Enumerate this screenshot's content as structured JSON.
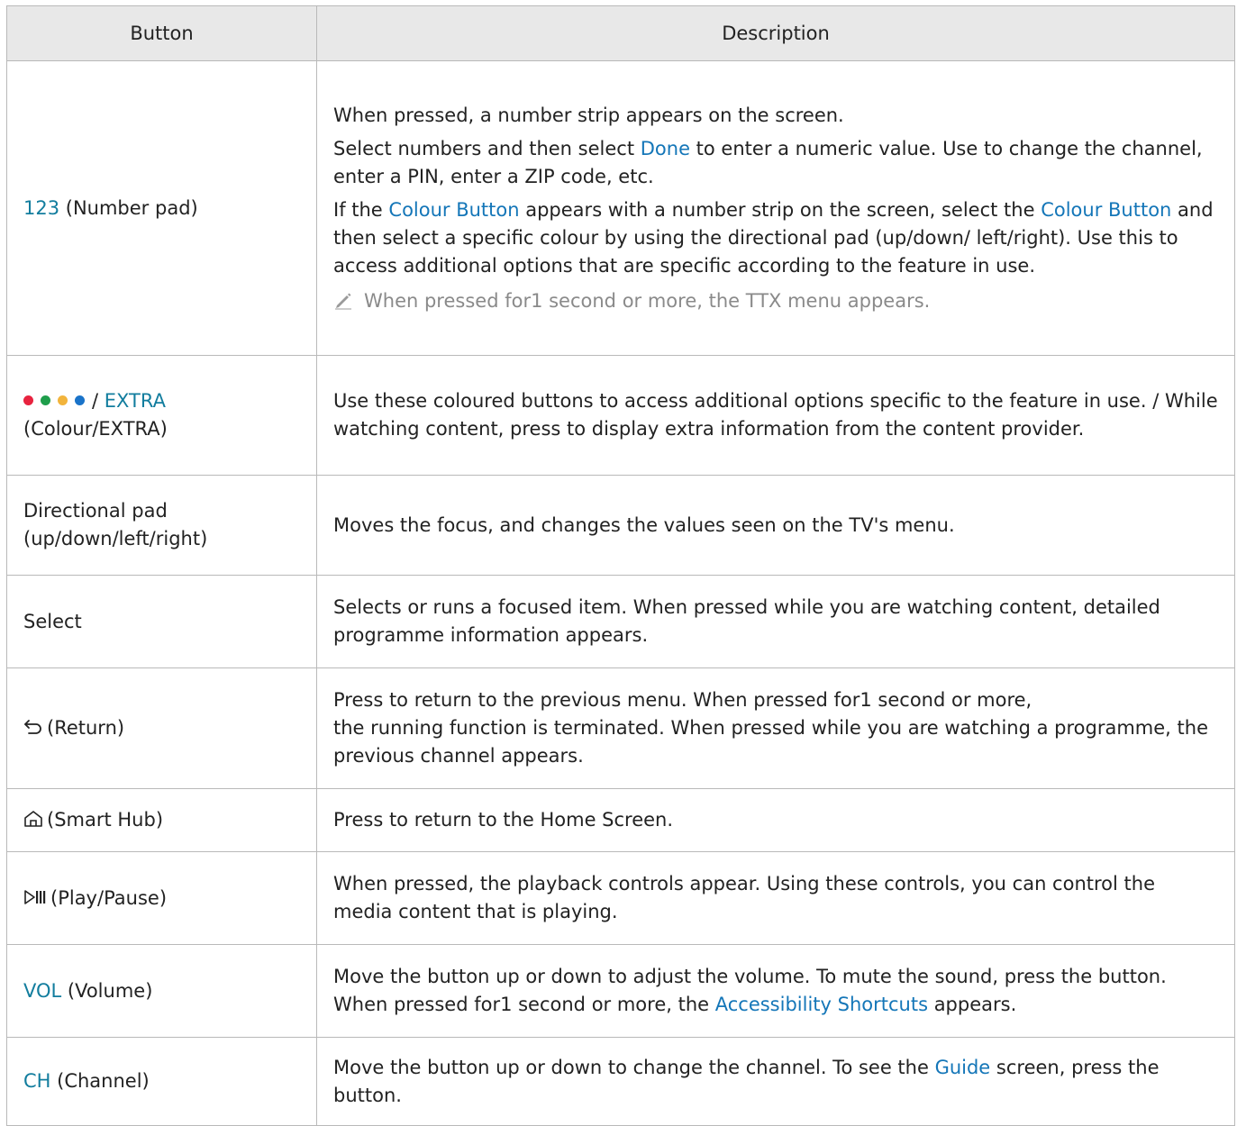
{
  "table": {
    "headers": {
      "button": "Button",
      "description": "Description"
    },
    "rows": [
      {
        "key": "123",
        "label": " (Number pad)",
        "desc": [
          "When pressed, a number strip appears on the screen.",
          [
            "Select numbers and then select ",
            "Done",
            " to enter a numeric value. Use to change the channel, enter a PIN, enter a ZIP code, etc."
          ],
          [
            "If the ",
            "Colour Button",
            " appears with a number strip on the screen, select the ",
            "Colour Button",
            " and then select a specific colour by using the directional pad (up/down/ left/right). Use this to access additional options that are specific according to the feature in use."
          ]
        ],
        "note": "When pressed for1 second or more, the TTX menu appears."
      },
      {
        "colours": [
          "#e8233f",
          "#1f9e4b",
          "#f2b43c",
          "#1a73c9"
        ],
        "sep": "/ ",
        "key": "EXTRA",
        "label2": "(Colour/EXTRA)",
        "desc": "Use these coloured buttons to access additional options specific to the feature in use. / While watching content, press to display extra information from the content provider."
      },
      {
        "label_lines": [
          "Directional pad",
          "(up/down/left/right)"
        ],
        "desc": "Moves the focus, and changes the values seen on the TV's menu."
      },
      {
        "label": "Select",
        "desc": "Selects or runs a focused item. When pressed while you are watching content, detailed programme information appears."
      },
      {
        "icon": "return-icon",
        "label": "(Return)",
        "desc_lines": [
          "Press to return to the previous menu. When pressed for1 second or more,",
          "the running function is terminated. When pressed while you are watching a programme, the previous channel appears."
        ]
      },
      {
        "icon": "home-icon",
        "label": "(Smart Hub)",
        "desc": "Press to return to the Home Screen."
      },
      {
        "icon": "play-pause-icon",
        "label": "(Play/Pause)",
        "desc": "When pressed, the playback controls appear. Using these controls, you can control the media content that is playing."
      },
      {
        "key": "VOL",
        "label": " (Volume)",
        "desc": [
          "Move the button up or down to adjust the volume. To mute the sound, press the button. When pressed for1 second or more, the ",
          "Accessibility Shortcuts",
          " appears."
        ]
      },
      {
        "key": "CH",
        "label": " (Channel)",
        "desc": [
          "Move the button up or down to change the channel. To see the ",
          "Guide",
          " screen, press the button."
        ]
      }
    ]
  }
}
